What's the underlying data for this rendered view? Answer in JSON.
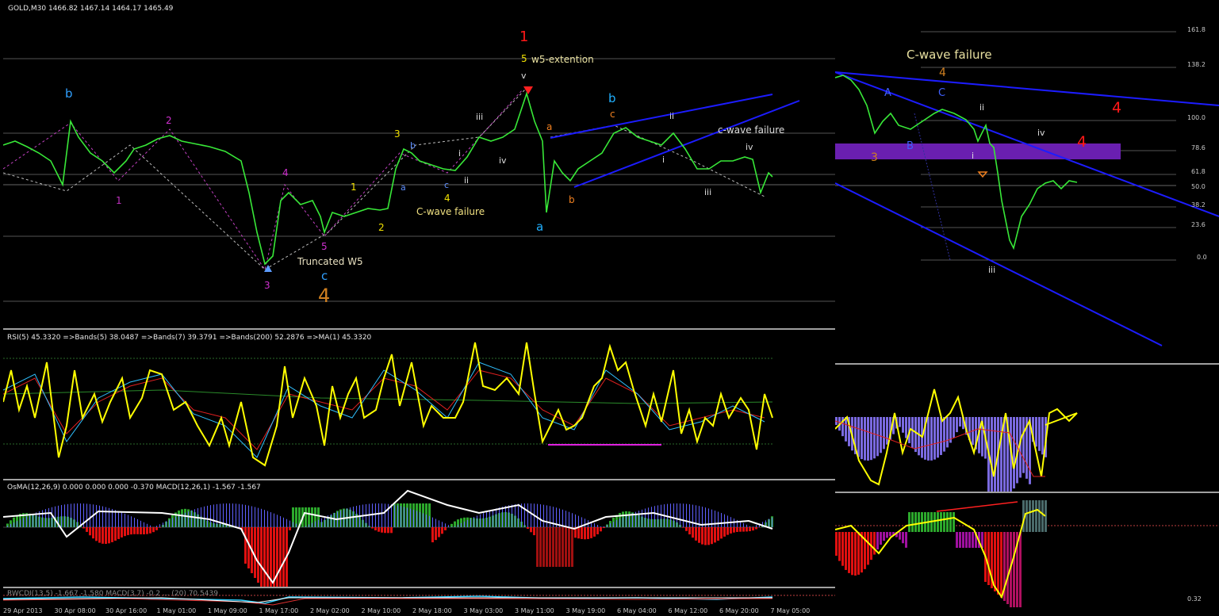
{
  "window": {
    "symbol_header": "GOLD,M30  1466.82 1467.14 1464.17 1465.49"
  },
  "colors": {
    "candle": "#38e838",
    "bg": "#000000",
    "rsi": "#ffff00",
    "trend": "#1c1cff",
    "fib_zone": "#6a1fb0",
    "hist_pos": "#2ca82c",
    "hist_neg": "#e01010",
    "macd": "#ffffff"
  },
  "main_labels": {
    "red_1": "1",
    "five": "5",
    "w5_ext": "w5-extention",
    "v": "v",
    "b_left": "b",
    "two_mag": "2",
    "one_mag": "1",
    "four_mag": "4",
    "three_mag": "3",
    "five_mag": "5",
    "truncated": "Truncated W5",
    "c_blue": "c",
    "four_orange": "4",
    "three_y": "3",
    "one_y": "1",
    "two_y": "2",
    "b_small": "b",
    "a_small": "a",
    "c_small": "c",
    "four_y": "4",
    "cwave_mid": "C-wave failure",
    "i_1": "i",
    "ii_1": "ii",
    "iii_1": "iii",
    "iv_1": "iv",
    "a_orange": "a",
    "b_orange": "b",
    "c_orange": "c",
    "a_cyan": "a",
    "b_cyan": "b",
    "ii_2": "ii",
    "i_2": "i",
    "iii_2": "iii",
    "iv_2": "iv",
    "cwave_right": "c-wave failure"
  },
  "right_labels": {
    "title": "C-wave failure",
    "four_orange": "4",
    "A": "A",
    "C": "C",
    "B": "B",
    "three_orange": "3",
    "ii": "ii",
    "i": "i",
    "iv": "iv",
    "iii": "iii",
    "four_red_top": "4",
    "four_red_mid": "4",
    "fib": [
      "161.8",
      "138.2",
      "100.0",
      "78.6",
      "61.8",
      "50.0",
      "38.2",
      "23.6",
      "0.0"
    ]
  },
  "rsi_header": "RSI(5) 45.3320  =>Bands(5) 38.0487  =>Bands(7) 39.3791  =>Bands(200) 52.2876  =>MA(1) 45.3320",
  "osma_header": "OsMA(12,26,9) 0.000 0.000 0.000 -0.370  MACD(12,26,1) -1.567 -1.567",
  "bottom_header": "RWCDI(13,5) -1.667 -1.580 MACD(3,7) -0.2 ... (20) 70.5439",
  "xaxis": [
    "29 Apr 2013",
    "30 Apr 08:00",
    "30 Apr 16:00",
    "1 May 01:00",
    "1 May 09:00",
    "1 May 17:00",
    "2 May 02:00",
    "2 May 10:00",
    "2 May 18:00",
    "3 May 03:00",
    "3 May 11:00",
    "3 May 19:00",
    "6 May 04:00",
    "6 May 12:00",
    "6 May 20:00",
    "7 May 05:00"
  ],
  "price_scale_bottom": "0.32"
}
